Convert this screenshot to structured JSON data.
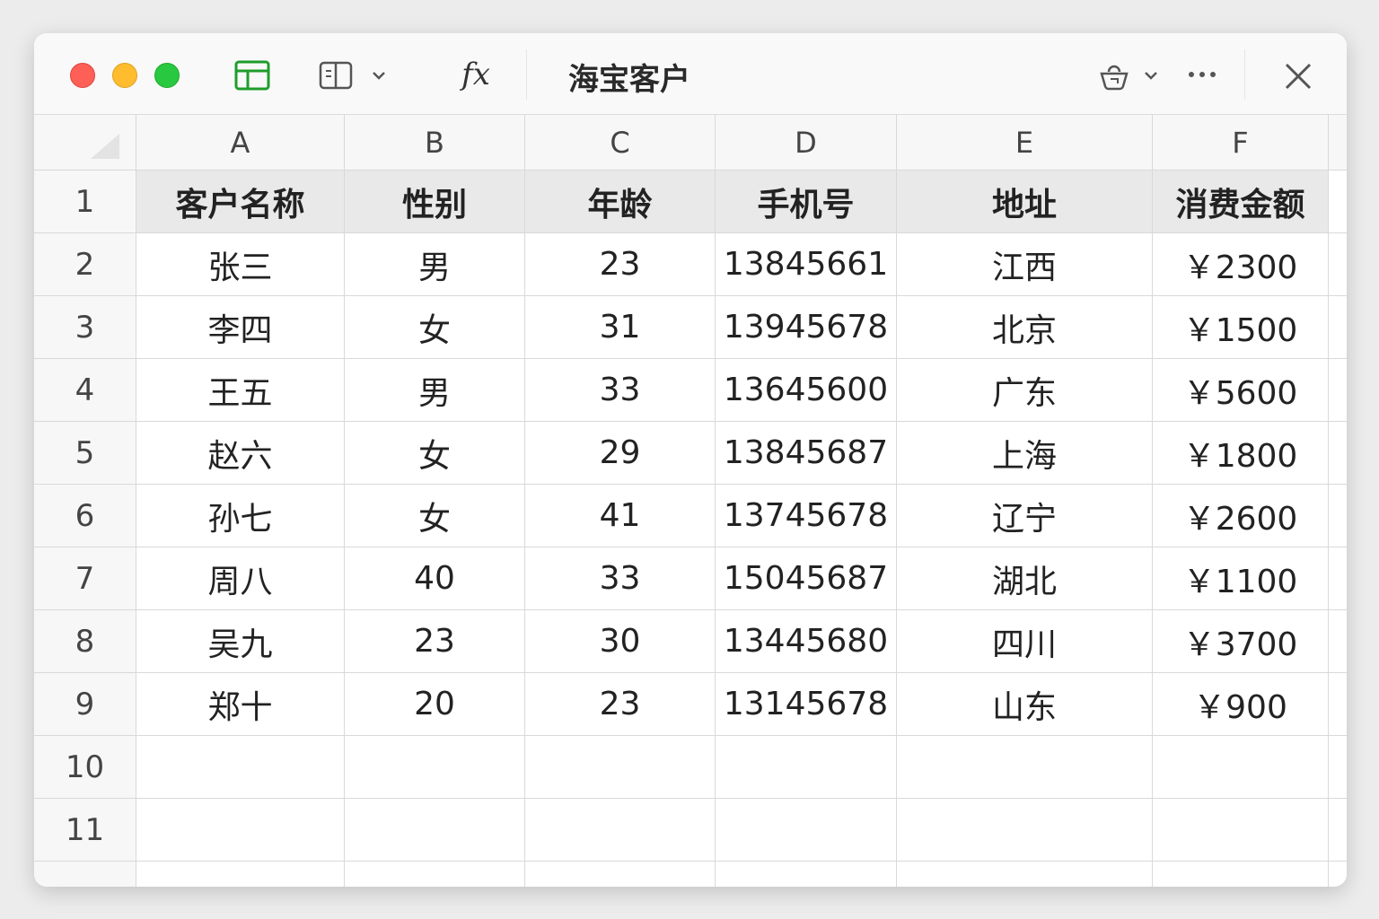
{
  "window": {
    "title": "海宝客户"
  },
  "toolbar": {
    "fx_label": "fx"
  },
  "columns": [
    "A",
    "B",
    "C",
    "D",
    "E",
    "F"
  ],
  "rows": [
    {
      "num": "1",
      "cells": [
        "客户名称",
        "性别",
        "年龄",
        "手机号",
        "地址",
        "消费金额"
      ]
    },
    {
      "num": "2",
      "cells": [
        "张三",
        "男",
        "23",
        "13845661",
        "江西",
        "￥2300"
      ]
    },
    {
      "num": "3",
      "cells": [
        "李四",
        "女",
        "31",
        "13945678",
        "北京",
        "￥1500"
      ]
    },
    {
      "num": "4",
      "cells": [
        "王五",
        "男",
        "33",
        "13645600",
        "广东",
        "￥5600"
      ]
    },
    {
      "num": "5",
      "cells": [
        "赵六",
        "女",
        "29",
        "13845687",
        "上海",
        "￥1800"
      ]
    },
    {
      "num": "6",
      "cells": [
        "孙七",
        "女",
        "41",
        "13745678",
        "辽宁",
        "￥2600"
      ]
    },
    {
      "num": "7",
      "cells": [
        "周八",
        "40",
        "33",
        "15045687",
        "湖北",
        "￥1100"
      ]
    },
    {
      "num": "8",
      "cells": [
        "吴九",
        "23",
        "30",
        "13445680",
        "四川",
        "￥3700"
      ]
    },
    {
      "num": "9",
      "cells": [
        "郑十",
        "20",
        "23",
        "13145678",
        "山东",
        "￥900"
      ]
    },
    {
      "num": "10",
      "cells": [
        "",
        "",
        "",
        "",
        "",
        ""
      ]
    },
    {
      "num": "11",
      "cells": [
        "",
        "",
        "",
        "",
        "",
        ""
      ]
    }
  ]
}
